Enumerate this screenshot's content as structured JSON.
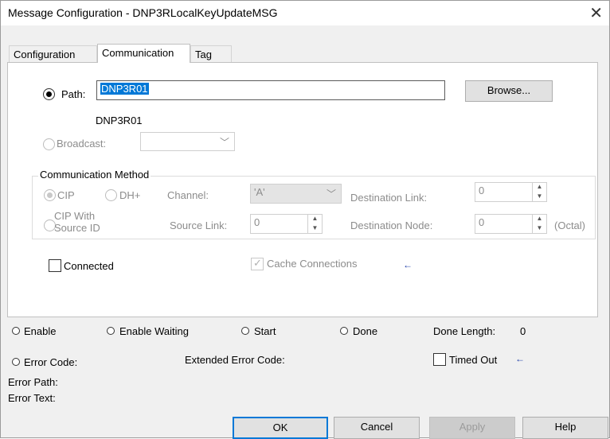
{
  "window": {
    "title": "Message Configuration - DNP3RLocalKeyUpdateMSG",
    "close_glyph": "✕"
  },
  "tabs": [
    {
      "label": "Configuration",
      "active": false
    },
    {
      "label": "Communication",
      "active": true
    },
    {
      "label": "Tag",
      "active": false
    }
  ],
  "path": {
    "label": "Path:",
    "value": "DNP3R01",
    "resolved": "DNP3R01",
    "browse_label": "Browse..."
  },
  "broadcast": {
    "label": "Broadcast:",
    "value": ""
  },
  "comm_method": {
    "title": "Communication Method",
    "cip_label": "CIP",
    "dhplus_label": "DH+",
    "channel_label": "Channel:",
    "channel_value": "'A'",
    "dest_link_label": "Destination Link:",
    "dest_link_value": "0",
    "cip_source_label_1": "CIP With",
    "cip_source_label_2": "Source ID",
    "source_link_label": "Source Link:",
    "source_link_value": "0",
    "dest_node_label": "Destination Node:",
    "dest_node_value": "0",
    "octal_label": "(Octal)"
  },
  "connected": {
    "label": "Connected",
    "checked": false
  },
  "cache": {
    "label": "Cache Connections",
    "checked": true
  },
  "status": {
    "enable": "Enable",
    "enable_waiting": "Enable Waiting",
    "start": "Start",
    "done": "Done",
    "done_length_label": "Done Length:",
    "done_length_value": "0",
    "error_code": "Error Code:",
    "extended_error_code": "Extended Error Code:",
    "timed_out": "Timed Out",
    "error_path": "Error Path:",
    "error_text": "Error Text:"
  },
  "buttons": {
    "ok": "OK",
    "cancel": "Cancel",
    "apply": "Apply",
    "help": "Help"
  },
  "colors": {
    "selection": "#0078d7",
    "arrow": "#1f3ea8"
  }
}
